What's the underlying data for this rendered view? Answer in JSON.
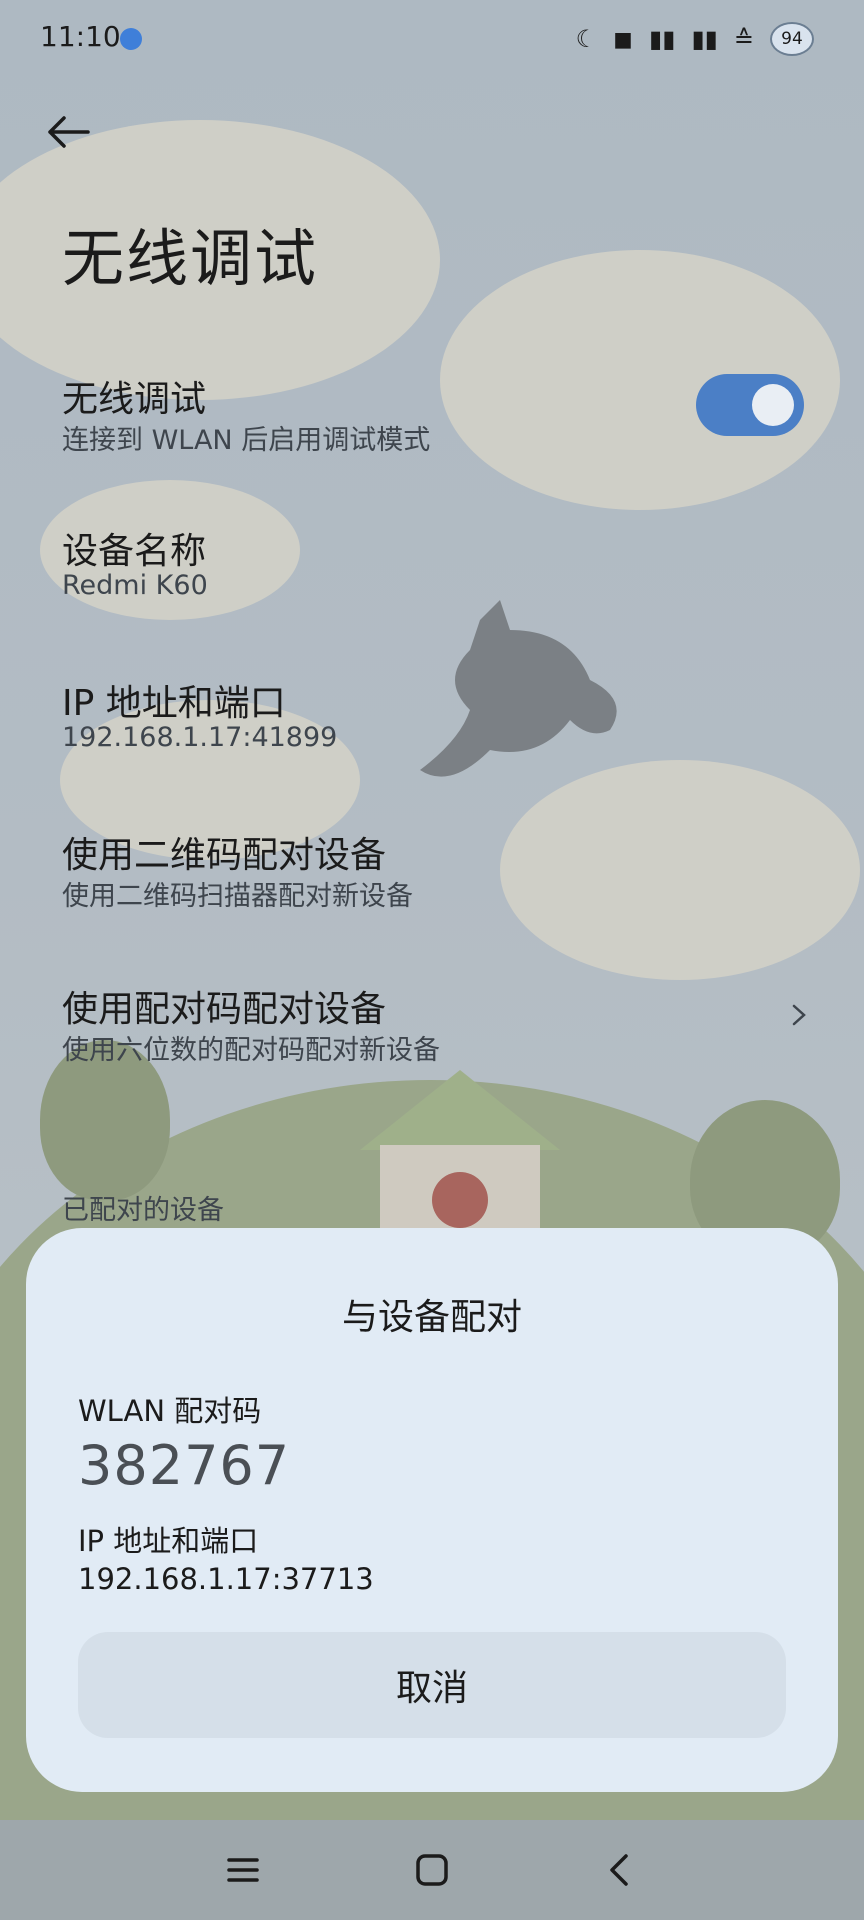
{
  "status_bar": {
    "time": "11:10",
    "battery": "94"
  },
  "header": {
    "title": "无线调试"
  },
  "settings": {
    "wireless_debugging": {
      "title": "无线调试",
      "subtitle": "连接到 WLAN 后启用调试模式",
      "enabled": true
    },
    "device_name": {
      "title": "设备名称",
      "value": "Redmi K60"
    },
    "ip_port": {
      "title": "IP 地址和端口",
      "value": "192.168.1.17:41899"
    },
    "qr_pair": {
      "title": "使用二维码配对设备",
      "subtitle": "使用二维码扫描器配对新设备"
    },
    "code_pair": {
      "title": "使用配对码配对设备",
      "subtitle": "使用六位数的配对码配对新设备"
    },
    "paired_section": "已配对的设备"
  },
  "dialog": {
    "title": "与设备配对",
    "code_label": "WLAN 配对码",
    "code": "382767",
    "address_label": "IP 地址和端口",
    "address": "192.168.1.17:37713",
    "cancel": "取消"
  },
  "colors": {
    "toggle_on": "#4b7fc6",
    "dialog_bg": "#e1ebf5",
    "cancel_bg": "#d5dfe9"
  }
}
